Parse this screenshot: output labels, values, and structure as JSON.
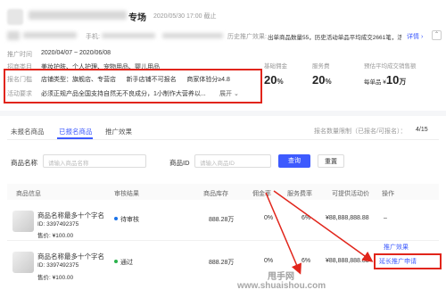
{
  "header": {
    "title_suffix": "专场",
    "date": "2020/05/30 17:00 截止",
    "phone_label": "手机:",
    "history_label": "历史推广效果:",
    "history_text": "出单商品数量55，历史活动单品平均成交2661笔，活动完...",
    "detail_link": "详情 ›"
  },
  "info": {
    "period_label": "推广时间",
    "period_value": "2020/04/07 ~ 2020/06/08",
    "category_label": "招商类目",
    "category_value": "美妆护肤、个人护理、宠物用品、婴儿用品",
    "threshold_label": "报名门槛",
    "threshold_value": "店铺类型：旗舰店、专营店      新手店铺不可报名      商家体验分≥4.8",
    "req_label": "活动要求",
    "req_value": "必须正规产品全国支持自然无不良成分，1小制作大营养以...",
    "expand": "展开"
  },
  "stats": [
    {
      "label": "基础佣金",
      "value": "20",
      "unit": "%",
      "prefix": ""
    },
    {
      "label": "服务费",
      "value": "20",
      "unit": "%",
      "prefix": ""
    },
    {
      "label": "预估平均成交销售额",
      "value": "10",
      "unit": "万",
      "prefix": "每单品 ¥"
    }
  ],
  "tabs": [
    "未报名商品",
    "已报名商品",
    "推广效果"
  ],
  "quota": {
    "text": "报名数量限制（已报名/可报名）：",
    "value": "4/15"
  },
  "filters": {
    "name_label": "商品名称",
    "name_placeholder": "请输入商品名称",
    "id_label": "商品ID",
    "id_placeholder": "请输入商品ID",
    "search": "查询",
    "reset": "重置"
  },
  "table": {
    "headers": [
      "商品信息",
      "审核结果",
      "商品库存",
      "佣金率",
      "服务费率",
      "可提供活动价",
      "操作"
    ],
    "rows": [
      {
        "name": "商品名称最多十个字名",
        "id": "ID: 3397492375",
        "price": "售价: ¥100.00",
        "status": "待审核",
        "status_color": "#1a73e8",
        "stock": "888.28万",
        "commission": "0%",
        "service": "6%",
        "activity_price": "¥88,888,888.88",
        "actions": [
          "–"
        ]
      },
      {
        "name": "商品名称最多十个字名",
        "id": "ID: 3397492375",
        "price": "售价: ¥100.00",
        "status": "通过",
        "status_color": "#2bb24c",
        "stock": "888.28万",
        "commission": "0%",
        "service": "6%",
        "activity_price": "¥88,888,888.88",
        "actions": [
          "推广效果",
          "延长推广申请"
        ]
      }
    ]
  },
  "watermark": {
    "line1": "甩手网",
    "line2": "www.shuaishou.com"
  },
  "colors": {
    "accent": "#3d5afe",
    "highlight": "#e1251b"
  }
}
